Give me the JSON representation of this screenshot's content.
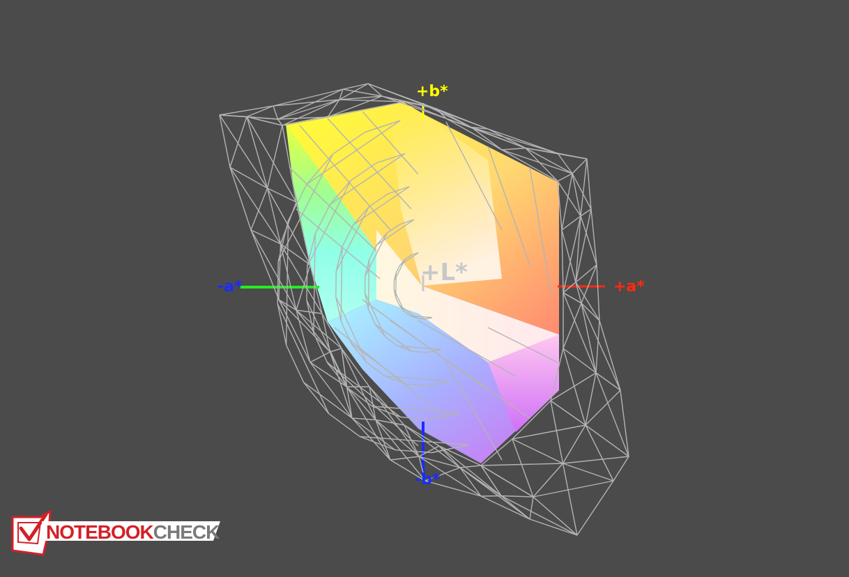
{
  "diagram": {
    "axes": {
      "b_plus": "+b*",
      "b_minus": "-b*",
      "a_minus": "-a*",
      "a_plus": "+a*",
      "lightness": "+L*"
    },
    "colors": {
      "background": "#4b4b4b",
      "wireframe": "#b4b4b4",
      "b_plus_axis": "#ffff00",
      "b_minus_axis": "#1a2cff",
      "a_minus_axis": "#22ee22",
      "a_plus_axis": "#ff2a10",
      "lightness_label": "#c8c8c8"
    }
  },
  "logo": {
    "part1": "NOTEBOOK",
    "part2": "CHECK",
    "icon": "notebookcheck-laptop-check-icon"
  }
}
